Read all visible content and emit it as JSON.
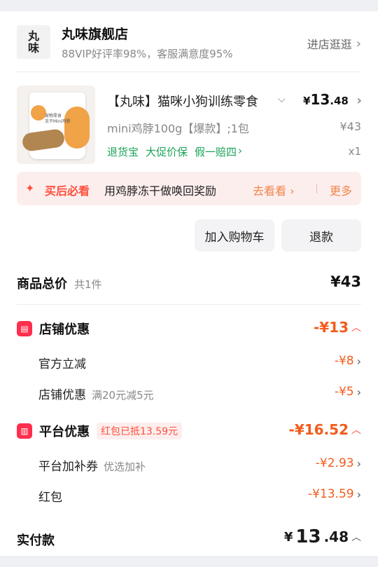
{
  "store": {
    "logo_text_1": "丸",
    "logo_text_2": "味",
    "name": "丸味旗舰店",
    "stats": "88VIP好评率98%，客服满意度95%",
    "visit_label": "进店逛逛"
  },
  "product": {
    "title": "【丸味】猫咪小狗训练零食",
    "price_symbol": "¥",
    "price_int": "13",
    "price_dec": ".48",
    "sku": "mini鸡脖100g【爆款】;1包",
    "original_price": "¥43",
    "tags": [
      "退货宝",
      "大促价保",
      "假一赔四"
    ],
    "quantity": "x1",
    "bag_text": "宠物零食\n冻干Mini鸡脖"
  },
  "banner": {
    "tag": "买后必看",
    "message": "用鸡脖冻干做唤回奖励",
    "action": "去看看",
    "more": "更多"
  },
  "actions": {
    "add_cart": "加入购物车",
    "refund": "退款"
  },
  "summary": {
    "total_label": "商品总价",
    "total_count": "共1件",
    "total_value": "¥43",
    "store_discount_label": "店铺优惠",
    "store_discount_value": "-¥13",
    "official_label": "官方立减",
    "official_value": "-¥8",
    "store_coupon_label": "店铺优惠",
    "store_coupon_desc": "满20元减5元",
    "store_coupon_value": "-¥5",
    "platform_label": "平台优惠",
    "platform_pill": "红包已抵13.59元",
    "platform_value": "-¥16.52",
    "subsidy_label": "平台加补券",
    "subsidy_desc": "优选加补",
    "subsidy_value": "-¥2.93",
    "redpacket_label": "红包",
    "redpacket_value": "-¥13.59",
    "paid_label": "实付款",
    "paid_symbol": "¥",
    "paid_int": "13",
    "paid_dec": ".48"
  },
  "colors": {
    "accent": "#ff4e3a",
    "discount": "#f25c1c",
    "guarantee_green": "#1aa35a"
  }
}
